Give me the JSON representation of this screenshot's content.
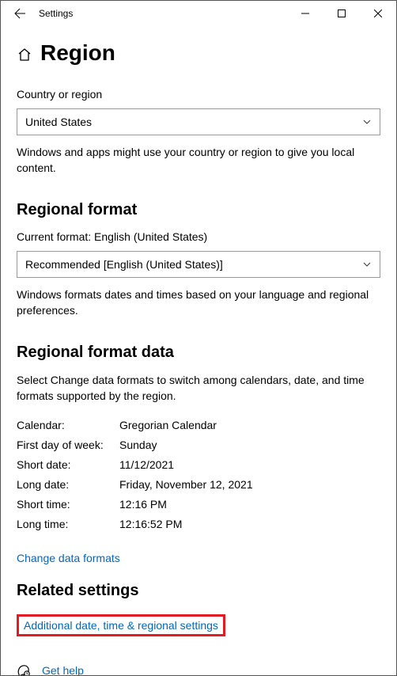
{
  "titlebar": {
    "title": "Settings"
  },
  "page": {
    "title": "Region"
  },
  "country": {
    "label": "Country or region",
    "value": "United States",
    "desc": "Windows and apps might use your country or region to give you local content."
  },
  "regional_format": {
    "title": "Regional format",
    "current_label": "Current format: English (United States)",
    "value": "Recommended [English (United States)]",
    "desc": "Windows formats dates and times based on your language and regional preferences."
  },
  "format_data": {
    "title": "Regional format data",
    "desc": "Select Change data formats to switch among calendars, date, and time formats supported by the region.",
    "rows": {
      "calendar": {
        "k": "Calendar:",
        "v": "Gregorian Calendar"
      },
      "firstday": {
        "k": "First day of week:",
        "v": "Sunday"
      },
      "shortdate": {
        "k": "Short date:",
        "v": "11/12/2021"
      },
      "longdate": {
        "k": "Long date:",
        "v": "Friday, November 12, 2021"
      },
      "shorttime": {
        "k": "Short time:",
        "v": "12:16 PM"
      },
      "longtime": {
        "k": "Long time:",
        "v": "12:16:52 PM"
      }
    },
    "change_link": "Change data formats"
  },
  "related": {
    "title": "Related settings",
    "link": "Additional date, time & regional settings"
  },
  "help": {
    "label": "Get help"
  }
}
